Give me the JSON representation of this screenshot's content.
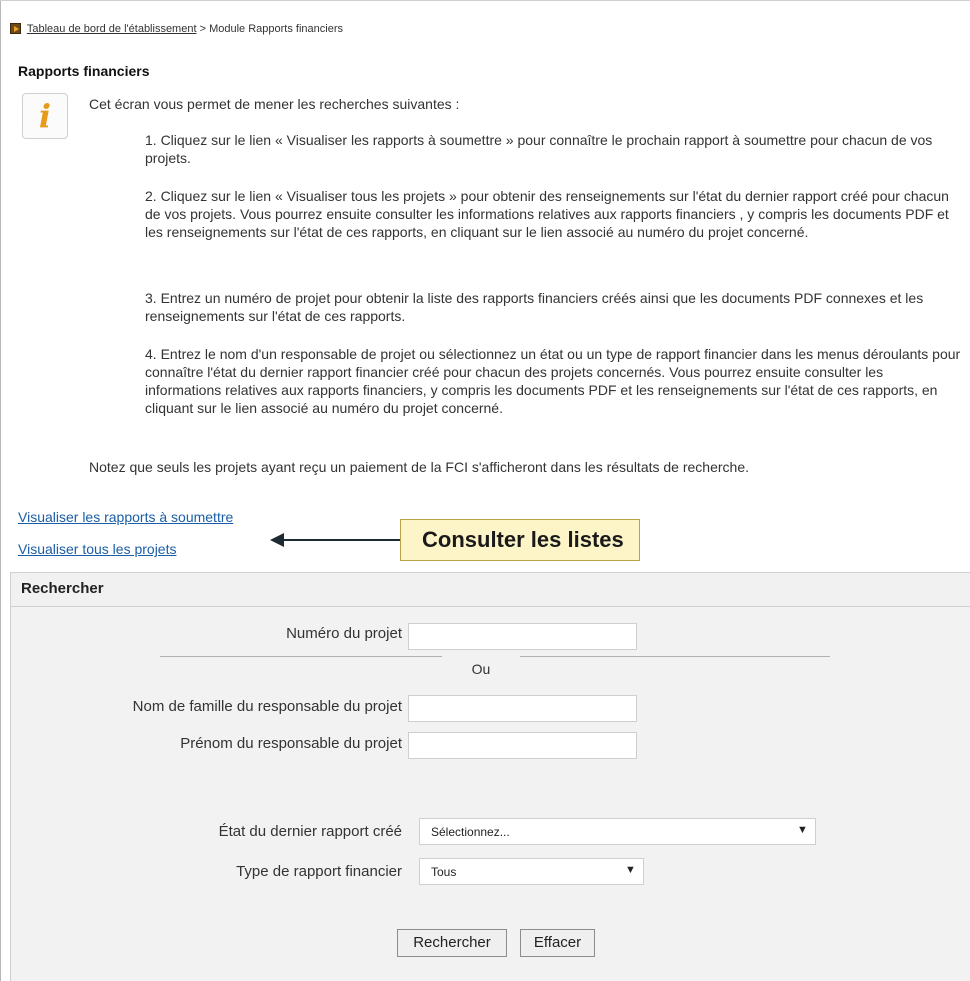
{
  "breadcrumb": {
    "icon": "arrow-right-square-icon",
    "link": "Tableau de bord de l'établissement",
    "separator": ">",
    "current": "Module Rapports financiers"
  },
  "page": {
    "title": "Rapports financiers"
  },
  "info": {
    "icon": "info-icon",
    "glyph": "i",
    "intro": "Cet écran vous permet de mener les recherches suivantes :",
    "steps": [
      "1. Cliquez sur le lien « Visualiser les rapports à soumettre » pour connaître le prochain rapport à soumettre pour chacun de vos projets.",
      "2. Cliquez sur le lien « Visualiser tous les projets » pour obtenir des renseignements sur l'état du dernier rapport créé pour chacun de vos projets. Vous pourrez ensuite consulter les informations relatives aux rapports financiers , y compris les documents PDF et les renseignements sur l'état de ces rapports, en cliquant sur le lien associé au numéro du projet concerné.",
      "3. Entrez un numéro de projet pour obtenir la liste des rapports financiers créés ainsi que les documents PDF connexes et les renseignements sur l'état de ces rapports.",
      "4. Entrez le nom d'un responsable de projet ou sélectionnez un état ou un type de rapport financier dans les menus déroulants pour connaître l'état du dernier rapport financier créé pour chacun des projets concernés. Vous pourrez ensuite consulter les informations relatives aux rapports financiers, y compris les documents PDF et les renseignements sur l'état de ces rapports, en cliquant sur le lien associé au numéro du projet concerné."
    ],
    "note": "Notez que seuls les projets ayant reçu un paiement de la FCI s'afficheront dans les résultats de recherche."
  },
  "links": {
    "rapports_a_soumettre": "Visualiser les rapports à soumettre",
    "tous_les_projets": "Visualiser tous les projets"
  },
  "callout": {
    "text": "Consulter les listes",
    "arrow_icon": "arrow-left-icon"
  },
  "search": {
    "title": "Rechercher",
    "numero_projet_label": "Numéro du projet",
    "numero_projet_value": "",
    "ou_label": "Ou",
    "nom_famille_label": "Nom de famille du responsable du projet",
    "nom_famille_value": "",
    "prenom_label": "Prénom du responsable du projet",
    "prenom_value": "",
    "etat_label": "État du dernier rapport créé",
    "etat_selected": "Sélectionnez...",
    "type_label": "Type de rapport financier",
    "type_selected": "Tous",
    "dropdown_glyph": "▼",
    "search_button": "Rechercher",
    "clear_button": "Effacer"
  }
}
